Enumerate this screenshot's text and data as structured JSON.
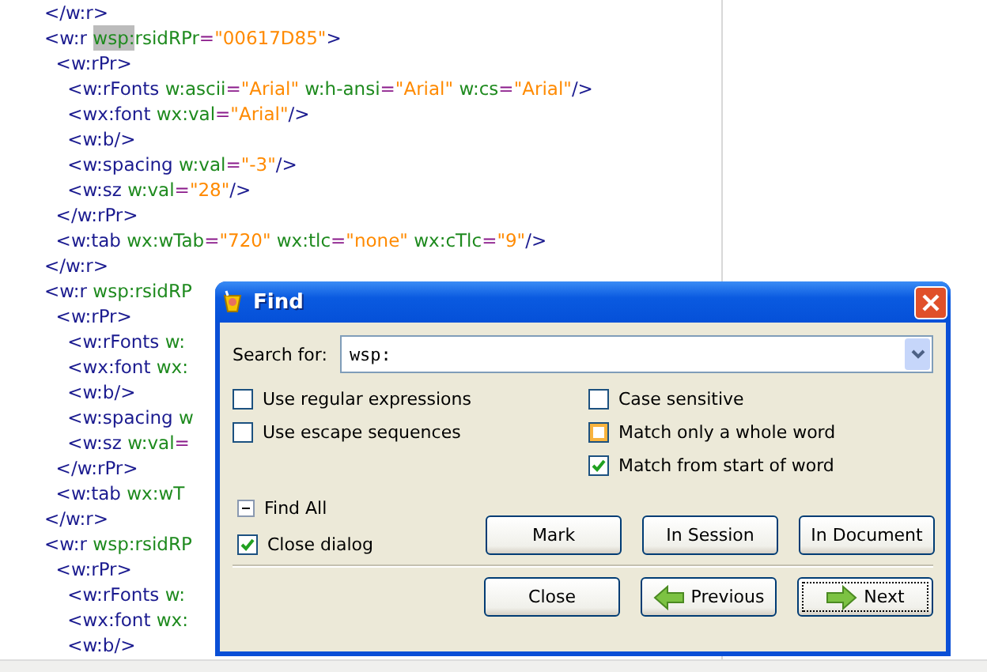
{
  "editor": {
    "lines": [
      {
        "tokens": [
          {
            "kind": "tag",
            "text": "</w:r>"
          }
        ]
      },
      {
        "tokens": [
          {
            "kind": "tag",
            "text": "<w:r "
          },
          {
            "kind": "match",
            "text": "wsp:"
          },
          {
            "kind": "attr",
            "text": "rsidRPr"
          },
          {
            "kind": "eq",
            "text": "="
          },
          {
            "kind": "value",
            "text": "\"00617D85\""
          },
          {
            "kind": "tag",
            "text": ">"
          }
        ]
      },
      {
        "tokens": [
          {
            "kind": "tag",
            "text": "  <w:rPr>"
          }
        ]
      },
      {
        "tokens": [
          {
            "kind": "tag",
            "text": "    <w:rFonts "
          },
          {
            "kind": "attr",
            "text": "w:ascii"
          },
          {
            "kind": "eq",
            "text": "="
          },
          {
            "kind": "value",
            "text": "\"Arial\" "
          },
          {
            "kind": "attr",
            "text": "w:h-ansi"
          },
          {
            "kind": "eq",
            "text": "="
          },
          {
            "kind": "value",
            "text": "\"Arial\" "
          },
          {
            "kind": "attr",
            "text": "w:cs"
          },
          {
            "kind": "eq",
            "text": "="
          },
          {
            "kind": "value",
            "text": "\"Arial\""
          },
          {
            "kind": "tag",
            "text": "/>"
          }
        ]
      },
      {
        "tokens": [
          {
            "kind": "tag",
            "text": "    <wx:font "
          },
          {
            "kind": "attr",
            "text": "wx:val"
          },
          {
            "kind": "eq",
            "text": "="
          },
          {
            "kind": "value",
            "text": "\"Arial\""
          },
          {
            "kind": "tag",
            "text": "/>"
          }
        ]
      },
      {
        "tokens": [
          {
            "kind": "tag",
            "text": "    <w:b/>"
          }
        ]
      },
      {
        "tokens": [
          {
            "kind": "tag",
            "text": "    <w:spacing "
          },
          {
            "kind": "attr",
            "text": "w:val"
          },
          {
            "kind": "eq",
            "text": "="
          },
          {
            "kind": "value",
            "text": "\"-3\""
          },
          {
            "kind": "tag",
            "text": "/>"
          }
        ]
      },
      {
        "tokens": [
          {
            "kind": "tag",
            "text": "    <w:sz "
          },
          {
            "kind": "attr",
            "text": "w:val"
          },
          {
            "kind": "eq",
            "text": "="
          },
          {
            "kind": "value",
            "text": "\"28\""
          },
          {
            "kind": "tag",
            "text": "/>"
          }
        ]
      },
      {
        "tokens": [
          {
            "kind": "tag",
            "text": "  </w:rPr>"
          }
        ]
      },
      {
        "tokens": [
          {
            "kind": "tag",
            "text": "  <w:tab "
          },
          {
            "kind": "attr",
            "text": "wx:wTab"
          },
          {
            "kind": "eq",
            "text": "="
          },
          {
            "kind": "value",
            "text": "\"720\" "
          },
          {
            "kind": "attr",
            "text": "wx:tlc"
          },
          {
            "kind": "eq",
            "text": "="
          },
          {
            "kind": "value",
            "text": "\"none\" "
          },
          {
            "kind": "attr",
            "text": "wx:cTlc"
          },
          {
            "kind": "eq",
            "text": "="
          },
          {
            "kind": "value",
            "text": "\"9\""
          },
          {
            "kind": "tag",
            "text": "/>"
          }
        ]
      },
      {
        "tokens": [
          {
            "kind": "tag",
            "text": "</w:r>"
          }
        ]
      },
      {
        "tokens": [
          {
            "kind": "tag",
            "text": "<w:r "
          },
          {
            "kind": "attr",
            "text": "wsp:rsidRP"
          }
        ]
      },
      {
        "tokens": [
          {
            "kind": "tag",
            "text": "  <w:rPr>"
          }
        ]
      },
      {
        "tokens": [
          {
            "kind": "tag",
            "text": "    <w:rFonts "
          },
          {
            "kind": "attr",
            "text": "w:"
          }
        ]
      },
      {
        "tokens": [
          {
            "kind": "tag",
            "text": "    <wx:font "
          },
          {
            "kind": "attr",
            "text": "wx:"
          }
        ]
      },
      {
        "tokens": [
          {
            "kind": "tag",
            "text": "    <w:b/>"
          }
        ]
      },
      {
        "tokens": [
          {
            "kind": "tag",
            "text": "    <w:spacing "
          },
          {
            "kind": "attr",
            "text": "w"
          }
        ]
      },
      {
        "tokens": [
          {
            "kind": "tag",
            "text": "    <w:sz "
          },
          {
            "kind": "attr",
            "text": "w:val"
          },
          {
            "kind": "eq",
            "text": "="
          }
        ]
      },
      {
        "tokens": [
          {
            "kind": "tag",
            "text": "  </w:rPr>"
          }
        ]
      },
      {
        "tokens": [
          {
            "kind": "tag",
            "text": "  <w:tab "
          },
          {
            "kind": "attr",
            "text": "wx:wT"
          }
        ]
      },
      {
        "tokens": [
          {
            "kind": "tag",
            "text": "</w:r>"
          }
        ]
      },
      {
        "tokens": [
          {
            "kind": "tag",
            "text": "<w:r "
          },
          {
            "kind": "attr",
            "text": "wsp:rsidRP"
          }
        ]
      },
      {
        "tokens": [
          {
            "kind": "tag",
            "text": "  <w:rPr>"
          }
        ]
      },
      {
        "tokens": [
          {
            "kind": "tag",
            "text": "    <w:rFonts "
          },
          {
            "kind": "attr",
            "text": "w:"
          }
        ]
      },
      {
        "tokens": [
          {
            "kind": "tag",
            "text": "    <wx:font "
          },
          {
            "kind": "attr",
            "text": "wx:"
          }
        ]
      },
      {
        "tokens": [
          {
            "kind": "tag",
            "text": "    <w:b/>"
          }
        ]
      }
    ]
  },
  "dialog": {
    "title": "Find",
    "search": {
      "label": "Search for:",
      "value": "wsp:"
    },
    "left_options": [
      {
        "label": "Use regular expressions",
        "checked": false,
        "hovered": false
      },
      {
        "label": "Use escape sequences",
        "checked": false,
        "hovered": false
      }
    ],
    "right_options": [
      {
        "label": "Case sensitive",
        "checked": false,
        "hovered": false
      },
      {
        "label": "Match only a whole word",
        "checked": false,
        "hovered": true
      },
      {
        "label": "Match from start of word",
        "checked": true,
        "hovered": false
      }
    ],
    "find_all": {
      "label": "Find All",
      "expanded": true
    },
    "close_dialog": {
      "label": "Close dialog",
      "checked": true
    },
    "find_all_buttons": [
      "Mark",
      "In Session",
      "In Document"
    ],
    "buttons": [
      {
        "label": "Close",
        "kind": "plain",
        "focused": false
      },
      {
        "label": "Previous",
        "kind": "back",
        "focused": false
      },
      {
        "label": "Next",
        "kind": "forward",
        "focused": true
      }
    ]
  }
}
